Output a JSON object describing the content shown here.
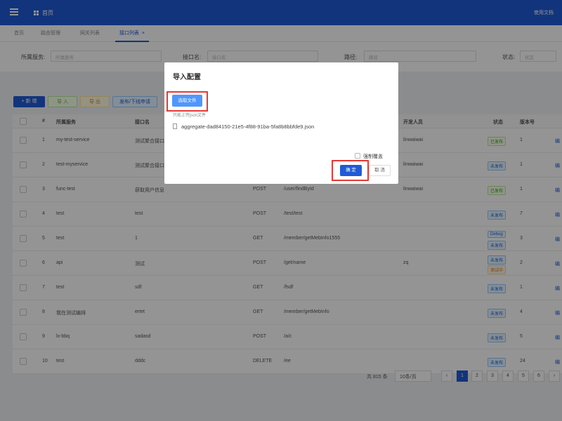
{
  "header": {
    "home_label": "首页",
    "right_text": "使用文档"
  },
  "tabs": [
    {
      "label": "首页"
    },
    {
      "label": "路由管理"
    },
    {
      "label": "网关列表"
    },
    {
      "label": "接口列表",
      "close": "×"
    }
  ],
  "filter": {
    "service_label": "所属服务:",
    "service_placeholder": "所属服务",
    "name_label": "接口名:",
    "name_placeholder": "接口名",
    "path_label": "路径:",
    "path_placeholder": "路径",
    "status_label": "状态:",
    "status_placeholder": "状态"
  },
  "toolbar": {
    "add": "+ 新 增",
    "import": "导 入",
    "export": "导 出",
    "publish": "发布/下线申请"
  },
  "table": {
    "headers": [
      "#",
      "所属服务",
      "接口名",
      "开发人员",
      "状态",
      "版本号"
    ],
    "rows": [
      {
        "no": "1",
        "service": "my-test-service",
        "name": "测试聚合接口",
        "method": "",
        "path": "",
        "dev": "linwaiwai",
        "status": "已发布",
        "status2": "",
        "version": "1"
      },
      {
        "no": "2",
        "service": "test-myservice",
        "name": "测试聚合接口",
        "method": "",
        "path": "",
        "dev": "linwaiwai",
        "status": "未发布",
        "status2": "",
        "version": "1"
      },
      {
        "no": "3",
        "service": "func-test",
        "name": "获取用户信息",
        "method": "POST",
        "path": "/user/findById",
        "dev": "linwaiwai",
        "status": "已发布",
        "status2": "",
        "version": "1"
      },
      {
        "no": "4",
        "service": "test",
        "name": "test",
        "method": "POST",
        "path": "/test/test",
        "dev": "",
        "status": "未发布",
        "status2": "",
        "version": "7"
      },
      {
        "no": "5",
        "service": "test",
        "name": "1",
        "method": "GET",
        "path": "/member/getMebInfo1555",
        "dev": "",
        "status": "Debug",
        "status2": "未发布",
        "version": "3"
      },
      {
        "no": "6",
        "service": "api",
        "name": "测试",
        "method": "POST",
        "path": "/get/name",
        "dev": "zq",
        "status": "未发布",
        "status2": "测试中",
        "version": "2"
      },
      {
        "no": "7",
        "service": "test",
        "name": "sdf",
        "method": "GET",
        "path": "/fsdf",
        "dev": "",
        "status": "未发布",
        "status2": "",
        "version": "1"
      },
      {
        "no": "8",
        "service": "我在测试编排",
        "name": "ertet",
        "method": "GET",
        "path": "/member/getMebInfo",
        "dev": "",
        "status": "未发布",
        "status2": "",
        "version": "4"
      },
      {
        "no": "9",
        "service": "lx-bbq",
        "name": "sadasd",
        "method": "POST",
        "path": "/a/c",
        "dev": "",
        "status": "未发布",
        "status2": "",
        "version": "5"
      },
      {
        "no": "10",
        "service": "test",
        "name": "dddc",
        "method": "DELETE",
        "path": "/ee",
        "dev": "",
        "status": "未发布",
        "status2": "",
        "version": "24"
      }
    ],
    "row_link": "编"
  },
  "pagination": {
    "total": "共 815 条",
    "page_size": "10条/页",
    "prev": "‹",
    "pages": [
      "1",
      "2",
      "3",
      "4",
      "5",
      "6"
    ],
    "next": "›"
  },
  "modal": {
    "title": "导入配置",
    "select_file": "选取文件",
    "hint": "只能上传json文件",
    "file_name": "aggregate-dad84150-21e5-4f88-91ba-5fa8b8bbfde9.json",
    "force_overwrite": "强制覆盖",
    "confirm": "确 定",
    "cancel": "取 消"
  },
  "colors": {
    "primary": "#1f5bd6",
    "highlight": "#e53935",
    "select_btn": "#4f97ff"
  }
}
